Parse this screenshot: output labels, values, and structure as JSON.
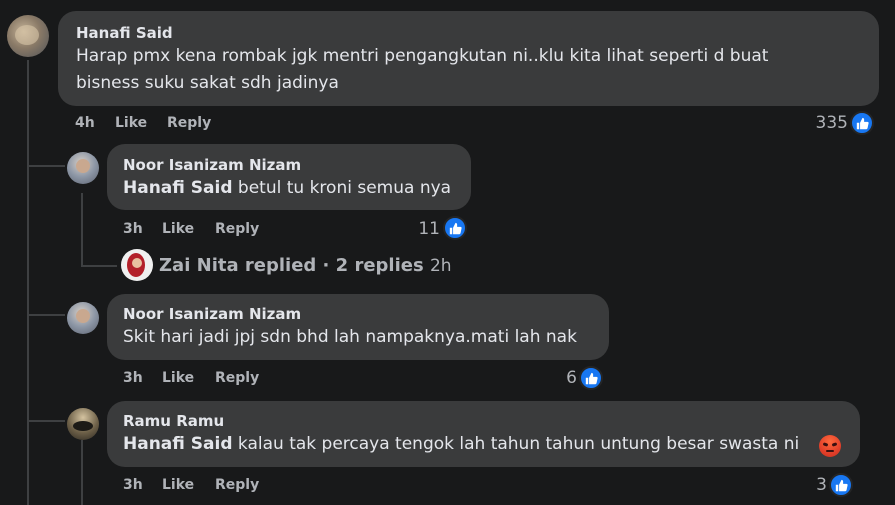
{
  "comments": [
    {
      "author": "Hanafi Said",
      "text_line1": "Harap pmx kena rombak jgk mentri pengangkutan ni..klu kita lihat seperti d buat",
      "text_line2": "bisness suku sakat sdh jadinya",
      "time": "4h",
      "like_label": "Like",
      "reply_label": "Reply",
      "like_count": "335"
    },
    {
      "author": "Noor Isanizam Nizam",
      "mention": "Hanafi Said",
      "text": " betul tu kroni semua nya",
      "time": "3h",
      "like_label": "Like",
      "reply_label": "Reply",
      "like_count": "11"
    },
    {
      "author": "Noor Isanizam Nizam",
      "text": "Skit hari jadi jpj sdn bhd lah nampaknya.mati lah nak",
      "time": "3h",
      "like_label": "Like",
      "reply_label": "Reply",
      "like_count": "6"
    },
    {
      "author": "Ramu Ramu",
      "mention": "Hanafi Said",
      "text": " kalau tak percaya tengok lah tahun tahun untung besar swasta ni",
      "emoji": "angry-face",
      "time": "3h",
      "like_label": "Like",
      "reply_label": "Reply",
      "like_count": "3"
    }
  ],
  "replies_link": {
    "label": "Zai Nita replied · 2 replies",
    "time": "2h"
  },
  "colors": {
    "background": "#18191a",
    "bubble": "#3a3b3c",
    "like_blue": "#1877f2",
    "muted": "#b0b3b8",
    "angry": "#e9710f"
  }
}
